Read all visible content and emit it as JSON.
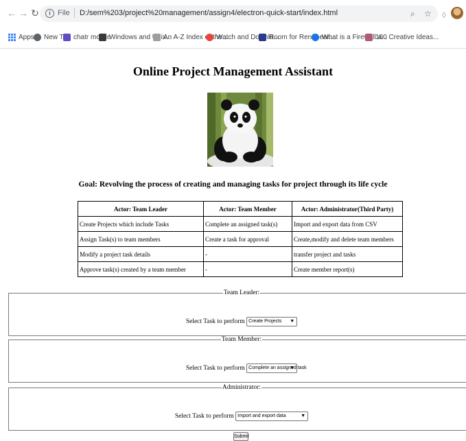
{
  "browser": {
    "url_scheme": "File",
    "url": "D:/sem%203/project%20management/assign4/electron-quick-start/index.html",
    "bookmarks": [
      {
        "label": "Apps",
        "color": "#4285f4"
      },
      {
        "label": "New Tab",
        "color": "#5f6368"
      },
      {
        "label": "chatr mobile",
        "color": "#5c4cc6"
      },
      {
        "label": "Windows and Unix...",
        "color": "#3a3a3a"
      },
      {
        "label": "An A-Z Index of the...",
        "color": "#9e9e9e"
      },
      {
        "label": "Watch and Downlo...",
        "color": "#e8453c"
      },
      {
        "label": "Room for Rent near...",
        "color": "#2b3a8c"
      },
      {
        "label": "What is a Firewall a...",
        "color": "#1a73e8"
      },
      {
        "label": "100 Creative Ideas...",
        "color": "#b05a7a"
      }
    ]
  },
  "page": {
    "title": "Online Project Management Assistant",
    "goal": "Goal: Revolving the process of creating and managing tasks for project through its life cycle",
    "table": {
      "headers": [
        "Actor: Team Leader",
        "Actor: Team Member",
        "Actor: Administrator(Third Party)"
      ],
      "rows": [
        [
          "Create Projects which include Tasks",
          "Complete an assigned task(s)",
          "Import and export data from CSV"
        ],
        [
          "Assign Task(s) to team members",
          "Create a task for approval",
          "Create,modify and delete team members"
        ],
        [
          "Modify a project task details",
          "-",
          "transfer project and tasks"
        ],
        [
          "Approve task(s) created by a team member",
          "-",
          "Create member report(s)"
        ]
      ]
    },
    "sections": [
      {
        "legend": "Team Leader:",
        "prompt": "Select Task to perform",
        "selected": "Create Projects"
      },
      {
        "legend": "Team Member:",
        "prompt": "Select Task to perform",
        "selected": "Complete an assigned task"
      },
      {
        "legend": "Administrator:",
        "prompt": "Select Task to perform",
        "selected": "Import and export data"
      }
    ],
    "submit_label": "Submit"
  }
}
